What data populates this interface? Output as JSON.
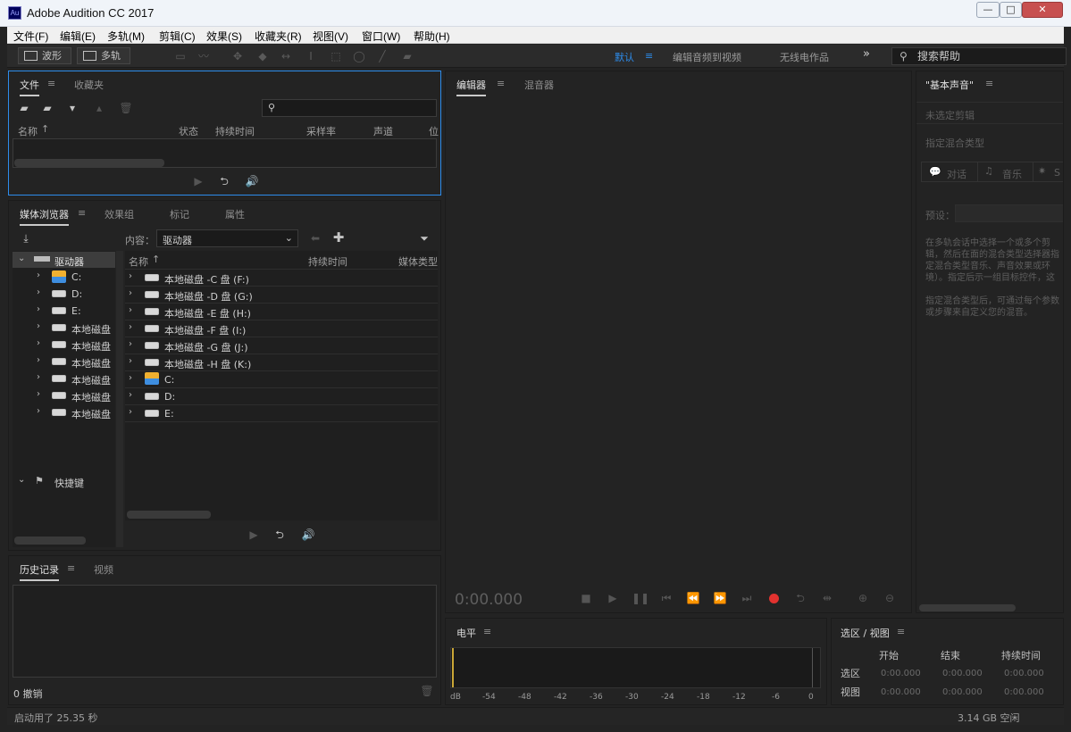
{
  "app": {
    "icon_text": "Au",
    "title": "Adobe Audition CC 2017"
  },
  "window_controls": {
    "minimize": "—",
    "maximize": "□",
    "close": "✕"
  },
  "menu": [
    "文件(F)",
    "编辑(E)",
    "多轨(M)",
    "剪辑(C)",
    "效果(S)",
    "收藏夹(R)",
    "视图(V)",
    "窗口(W)",
    "帮助(H)"
  ],
  "toolbar": {
    "waveform_label": "波形",
    "multitrack_label": "多轨",
    "workspaces": [
      "默认",
      "编辑音频到视频",
      "无线电作品"
    ],
    "more": "»",
    "search_placeholder": "搜索帮助"
  },
  "files_panel": {
    "tabs": [
      "文件",
      "收藏夹"
    ],
    "columns": [
      "名称",
      "状态",
      "持续时间",
      "采样率",
      "声道",
      "位"
    ]
  },
  "media_browser": {
    "tabs": [
      "媒体浏览器",
      "效果组",
      "标记",
      "属性"
    ],
    "content_label": "内容：",
    "content_value": "驱动器",
    "tree_root": "驱动器",
    "tree_items": [
      "C:",
      "D:",
      "E:",
      "本地磁盘",
      "本地磁盘",
      "本地磁盘",
      "本地磁盘",
      "本地磁盘",
      "本地磁盘"
    ],
    "shortcuts": "快捷键",
    "columns": [
      "名称",
      "持续时间",
      "媒体类型"
    ],
    "list_items": [
      "本地磁盘 -C 盘 (F:)",
      "本地磁盘 -D 盘 (G:)",
      "本地磁盘 -E 盘 (H:)",
      "本地磁盘 -F 盘 (I:)",
      "本地磁盘 -G 盘 (J:)",
      "本地磁盘 -H 盘 (K:)",
      "C:",
      "D:",
      "E:"
    ]
  },
  "history": {
    "tabs": [
      "历史记录",
      "视频"
    ],
    "undo_count": "0 撤销"
  },
  "editor": {
    "tabs": [
      "编辑器",
      "混音器"
    ],
    "timecode": "0:00.000"
  },
  "essential_sound": {
    "title": "\"基本声音\"",
    "no_clip": "未选定剪辑",
    "assign_type": "指定混合类型",
    "types": [
      "对话",
      "音乐",
      "S"
    ],
    "preset_label": "预设：",
    "description1": "在多轨会话中选择一个或多个剪辑，然后在面的混合类型选择器指定混合类型音乐、声音效果或环境）。指定后示一组目标控件，这些控件常用型的音频元素。",
    "description2": "指定混合类型后，可通过每个参数或步骤来自定义您的混音。"
  },
  "levels": {
    "title": "电平",
    "scale": [
      "dB",
      "-54",
      "-48",
      "-42",
      "-36",
      "-30",
      "-24",
      "-18",
      "-12",
      "-6",
      "0"
    ]
  },
  "selection_view": {
    "title": "选区 / 视图",
    "columns": [
      "开始",
      "结束",
      "持续时间"
    ],
    "rows": [
      {
        "label": "选区",
        "start": "0:00.000",
        "end": "0:00.000",
        "duration": "0:00.000"
      },
      {
        "label": "视图",
        "start": "0:00.000",
        "end": "0:00.000",
        "duration": "0:00.000"
      }
    ]
  },
  "status": {
    "left": "启动用了 25.35 秒",
    "right": "3.14 GB 空闲"
  }
}
